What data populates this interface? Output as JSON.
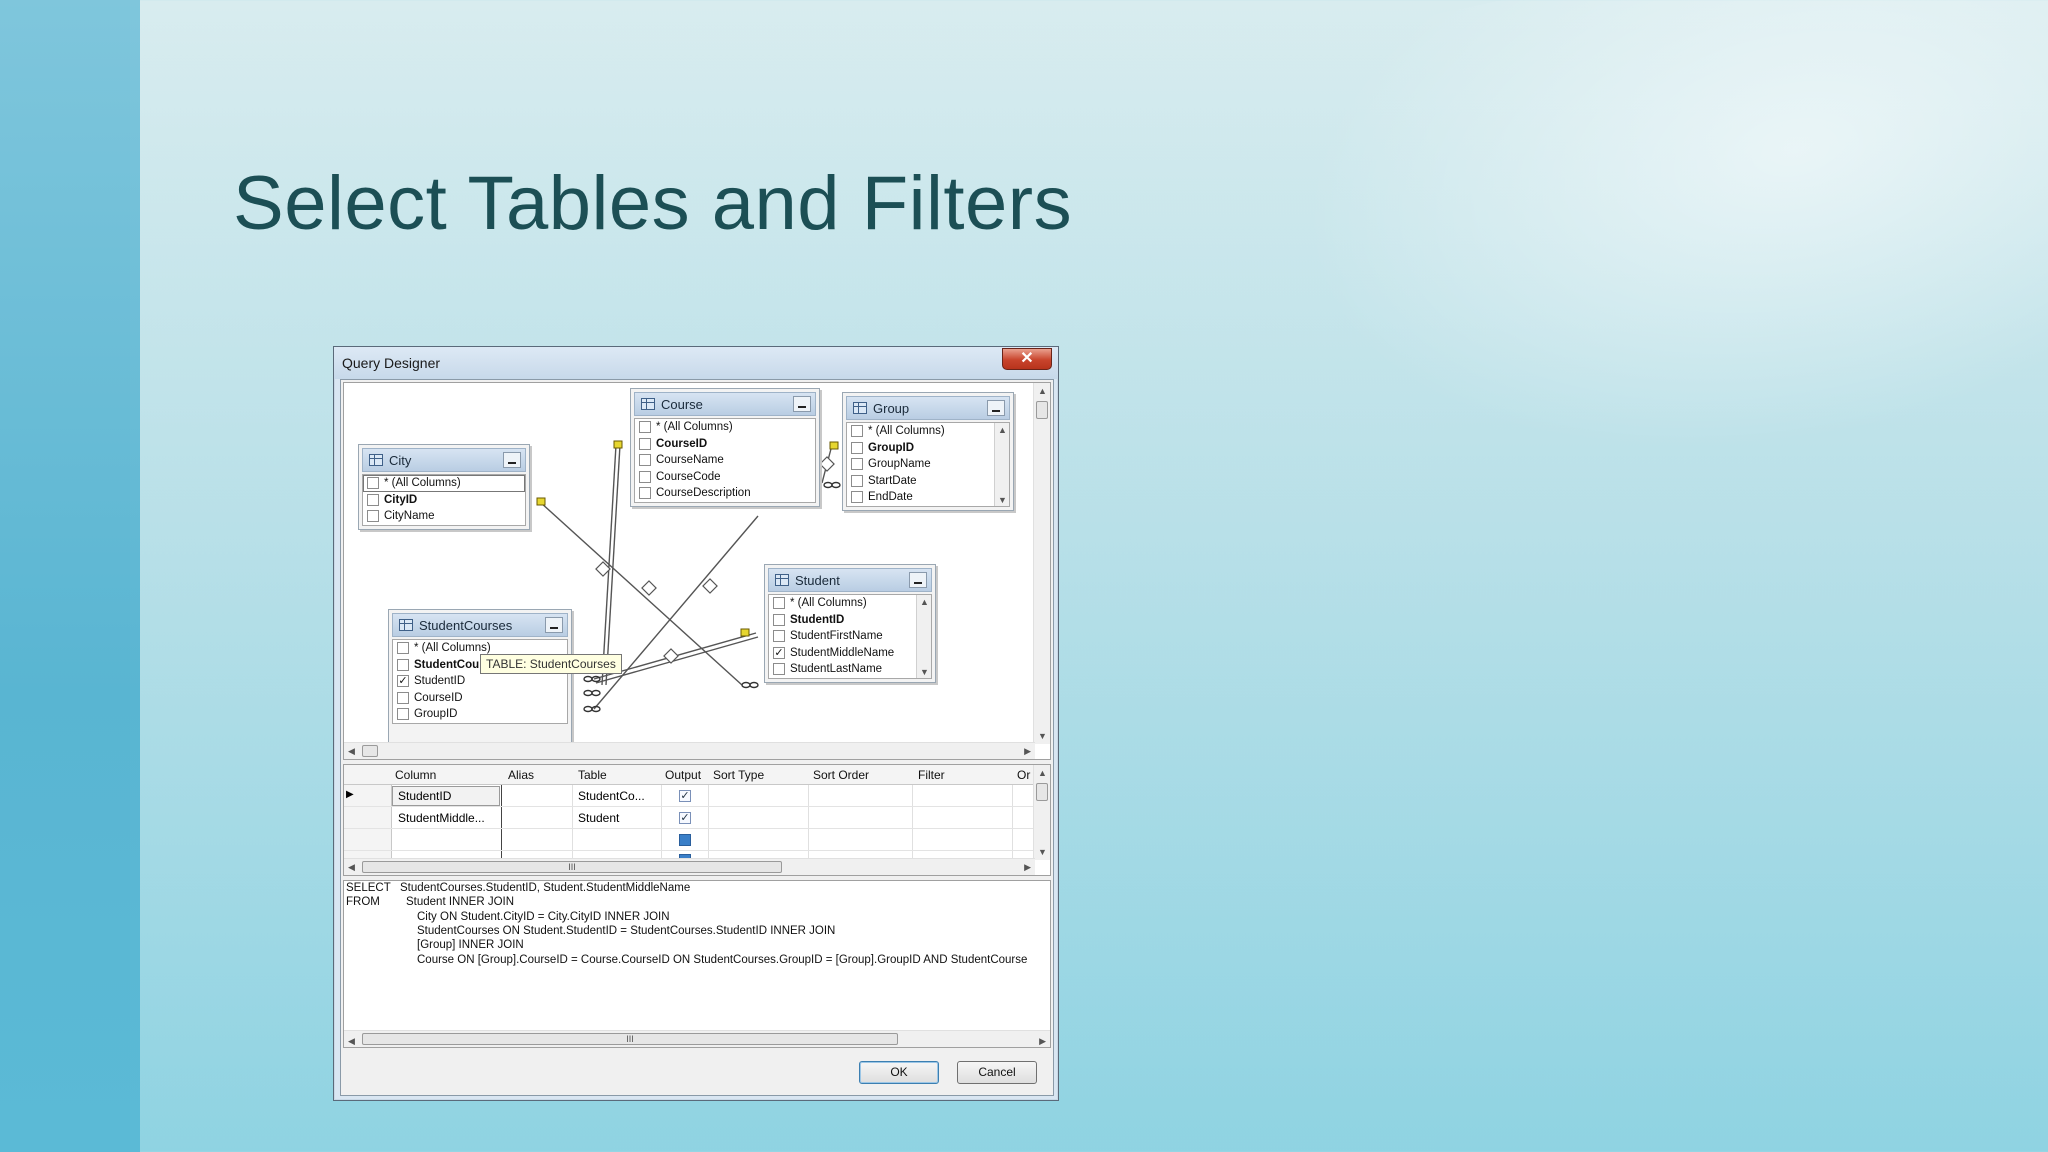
{
  "slide": {
    "title": "Select Tables and Filters"
  },
  "dialog": {
    "title": "Query Designer",
    "close_label": "✕",
    "ok_label": "OK",
    "cancel_label": "Cancel"
  },
  "diagram": {
    "tables": {
      "city": {
        "name": "City",
        "columns": [
          "* (All Columns)",
          "CityID",
          "CityName"
        ]
      },
      "course": {
        "name": "Course",
        "columns": [
          "* (All Columns)",
          "CourseID",
          "CourseName",
          "CourseCode",
          "CourseDescription"
        ]
      },
      "group": {
        "name": "Group",
        "columns": [
          "* (All Columns)",
          "GroupID",
          "GroupName",
          "StartDate",
          "EndDate"
        ]
      },
      "student": {
        "name": "Student",
        "columns": [
          "* (All Columns)",
          "StudentID",
          "StudentFirstName",
          "StudentMiddleName",
          "StudentLastName"
        ]
      },
      "studentcourses": {
        "name": "StudentCourses",
        "columns": [
          "* (All Columns)",
          "StudentCou",
          "StudentID",
          "CourseID",
          "GroupID"
        ]
      }
    },
    "tooltip": "TABLE: StudentCourses"
  },
  "grid": {
    "headers": [
      "Column",
      "Alias",
      "Table",
      "Output",
      "Sort Type",
      "Sort Order",
      "Filter",
      "Or"
    ],
    "rows": [
      {
        "column": "StudentID",
        "alias": "",
        "table": "StudentCo...",
        "output": "✓"
      },
      {
        "column": "StudentMiddle...",
        "alias": "",
        "table": "Student",
        "output": "✓"
      }
    ],
    "hscroll_grip": "III"
  },
  "sql": {
    "select_kw": "SELECT",
    "from_kw": "FROM",
    "lines": [
      "StudentCourses.StudentID, Student.StudentMiddleName",
      "Student INNER JOIN",
      "City ON Student.CityID = City.CityID INNER JOIN",
      "StudentCourses ON Student.StudentID = StudentCourses.StudentID INNER JOIN",
      "[Group] INNER JOIN",
      "Course ON [Group].CourseID = Course.CourseID ON StudentCourses.GroupID = [Group].GroupID AND StudentCourse"
    ],
    "hscroll_grip": "III"
  }
}
